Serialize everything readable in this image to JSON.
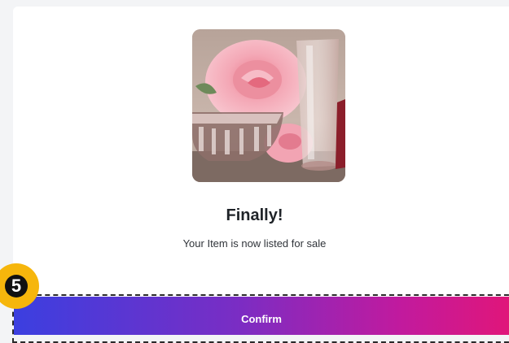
{
  "listing_success": {
    "title": "Finally!",
    "message": "Your Item is now listed for sale",
    "confirm_label": "Confirm"
  },
  "tutorial": {
    "step_number": "5"
  },
  "artwork": {
    "description_icon": "rose-still-life-image"
  },
  "colors": {
    "button_gradient_start": "#3b3fe0",
    "button_gradient_end": "#e0167a",
    "badge": "#f6b60c"
  }
}
